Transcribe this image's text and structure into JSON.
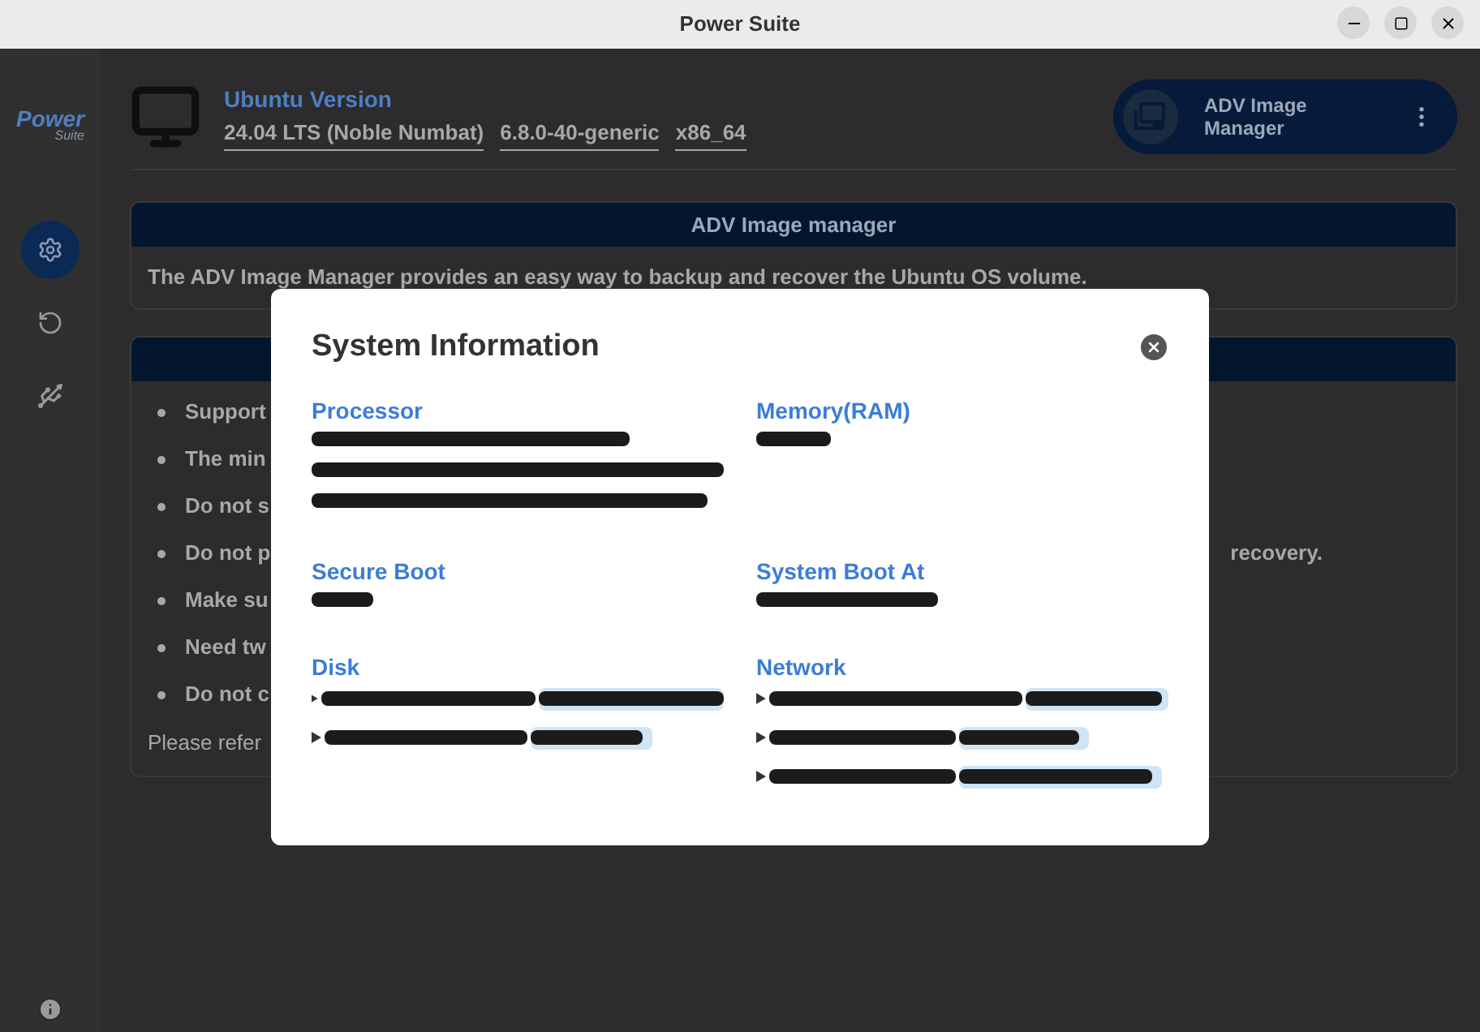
{
  "window": {
    "title": "Power Suite"
  },
  "sidebar": {
    "logo": {
      "title": "Power",
      "subtitle": "Suite"
    },
    "items": [
      {
        "kind": "gear",
        "selected": true
      },
      {
        "kind": "reload",
        "selected": false
      },
      {
        "kind": "usb",
        "selected": false
      }
    ]
  },
  "system": {
    "label": "Ubuntu Version",
    "values": [
      "24.04 LTS (Noble Numbat)",
      "6.8.0-40-generic",
      "x86_64"
    ]
  },
  "app_chip": {
    "label": "ADV Image Manager"
  },
  "intro_card": {
    "title": "ADV Image manager",
    "text": "The ADV Image Manager provides an easy way to backup and recover the Ubuntu OS volume."
  },
  "notes_card": {
    "bullets": [
      {
        "text": "Support"
      },
      {
        "text": "The min"
      },
      {
        "text": "Do not s"
      },
      {
        "text": "Do not p",
        "tail": "recovery."
      },
      {
        "text": "Make su"
      },
      {
        "text": "Need tw"
      },
      {
        "text": "Do not c"
      }
    ],
    "footer": "Please refer"
  },
  "dialog": {
    "title": "System Information",
    "sections": [
      {
        "label": "Processor",
        "kind": "text"
      },
      {
        "label": "Memory(RAM)",
        "kind": "text"
      },
      {
        "label": "Secure Boot",
        "kind": "text"
      },
      {
        "label": "System Boot At",
        "kind": "text"
      },
      {
        "label": "Disk",
        "kind": "list"
      },
      {
        "label": "Network",
        "kind": "list"
      }
    ]
  }
}
